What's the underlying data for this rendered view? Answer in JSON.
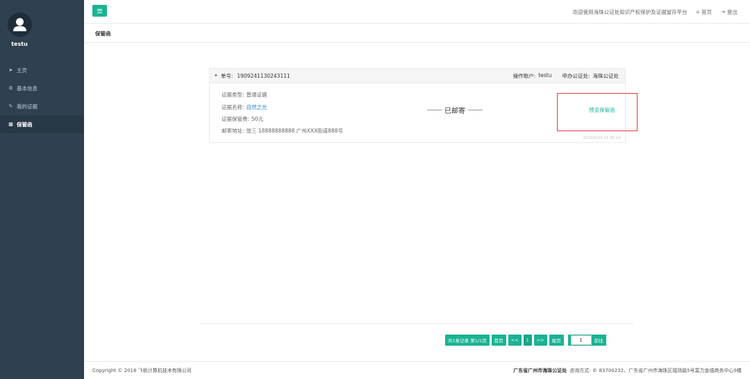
{
  "sidebar": {
    "username": "testu",
    "items": [
      {
        "label": "主页",
        "icon": "send-icon"
      },
      {
        "label": "基本信息",
        "icon": "gear-icon"
      },
      {
        "label": "我的证据",
        "icon": "wrench-icon"
      },
      {
        "label": "保管函",
        "icon": "table-icon",
        "active": true
      }
    ]
  },
  "topbar": {
    "welcome": "欢迎使用海珠公证处知识产权保护及证据留存平台",
    "home_label": "首页",
    "logout_label": "登出"
  },
  "breadcrumb": "保管函",
  "card": {
    "order_label": "单号:",
    "order_value": "1909241130243111",
    "operator_label": "操作账户:",
    "operator_value": "testu",
    "office_label": "申办公证处:",
    "office_value": "海珠公证处",
    "fields": [
      {
        "label": "证据类型:",
        "value": "普通证据"
      },
      {
        "label": "证据名称:",
        "value": "自然之光"
      },
      {
        "label": "证据保管费:",
        "value": "50元"
      },
      {
        "label": "邮寄地址:",
        "value": "张三 18888888888 广州XXX街道888号"
      }
    ],
    "status": "已邮寄",
    "preview_link": "预览保管函",
    "timestamp": "2019/9/24 11:30:24"
  },
  "pagination": {
    "summary": "共1条记录 第1/1页",
    "first": "首页",
    "prev": "<<",
    "current": "1",
    "next": ">>",
    "last": "尾页",
    "input_value": "1",
    "go": "前往"
  },
  "footer": {
    "copyright": "Copyright © 2018 飞帆计算机技术有限公司",
    "office": "广东省广州市海珠公证处",
    "consult": "咨询方式:",
    "phone": "83700232、广东省广州市海珠区福场路5号富力金禧商务中心9楼"
  },
  "colors": {
    "sidebar_bg": "#2f4050",
    "accent": "#1ab394",
    "link": "#1c84c6",
    "highlight": "#e83a3a"
  }
}
